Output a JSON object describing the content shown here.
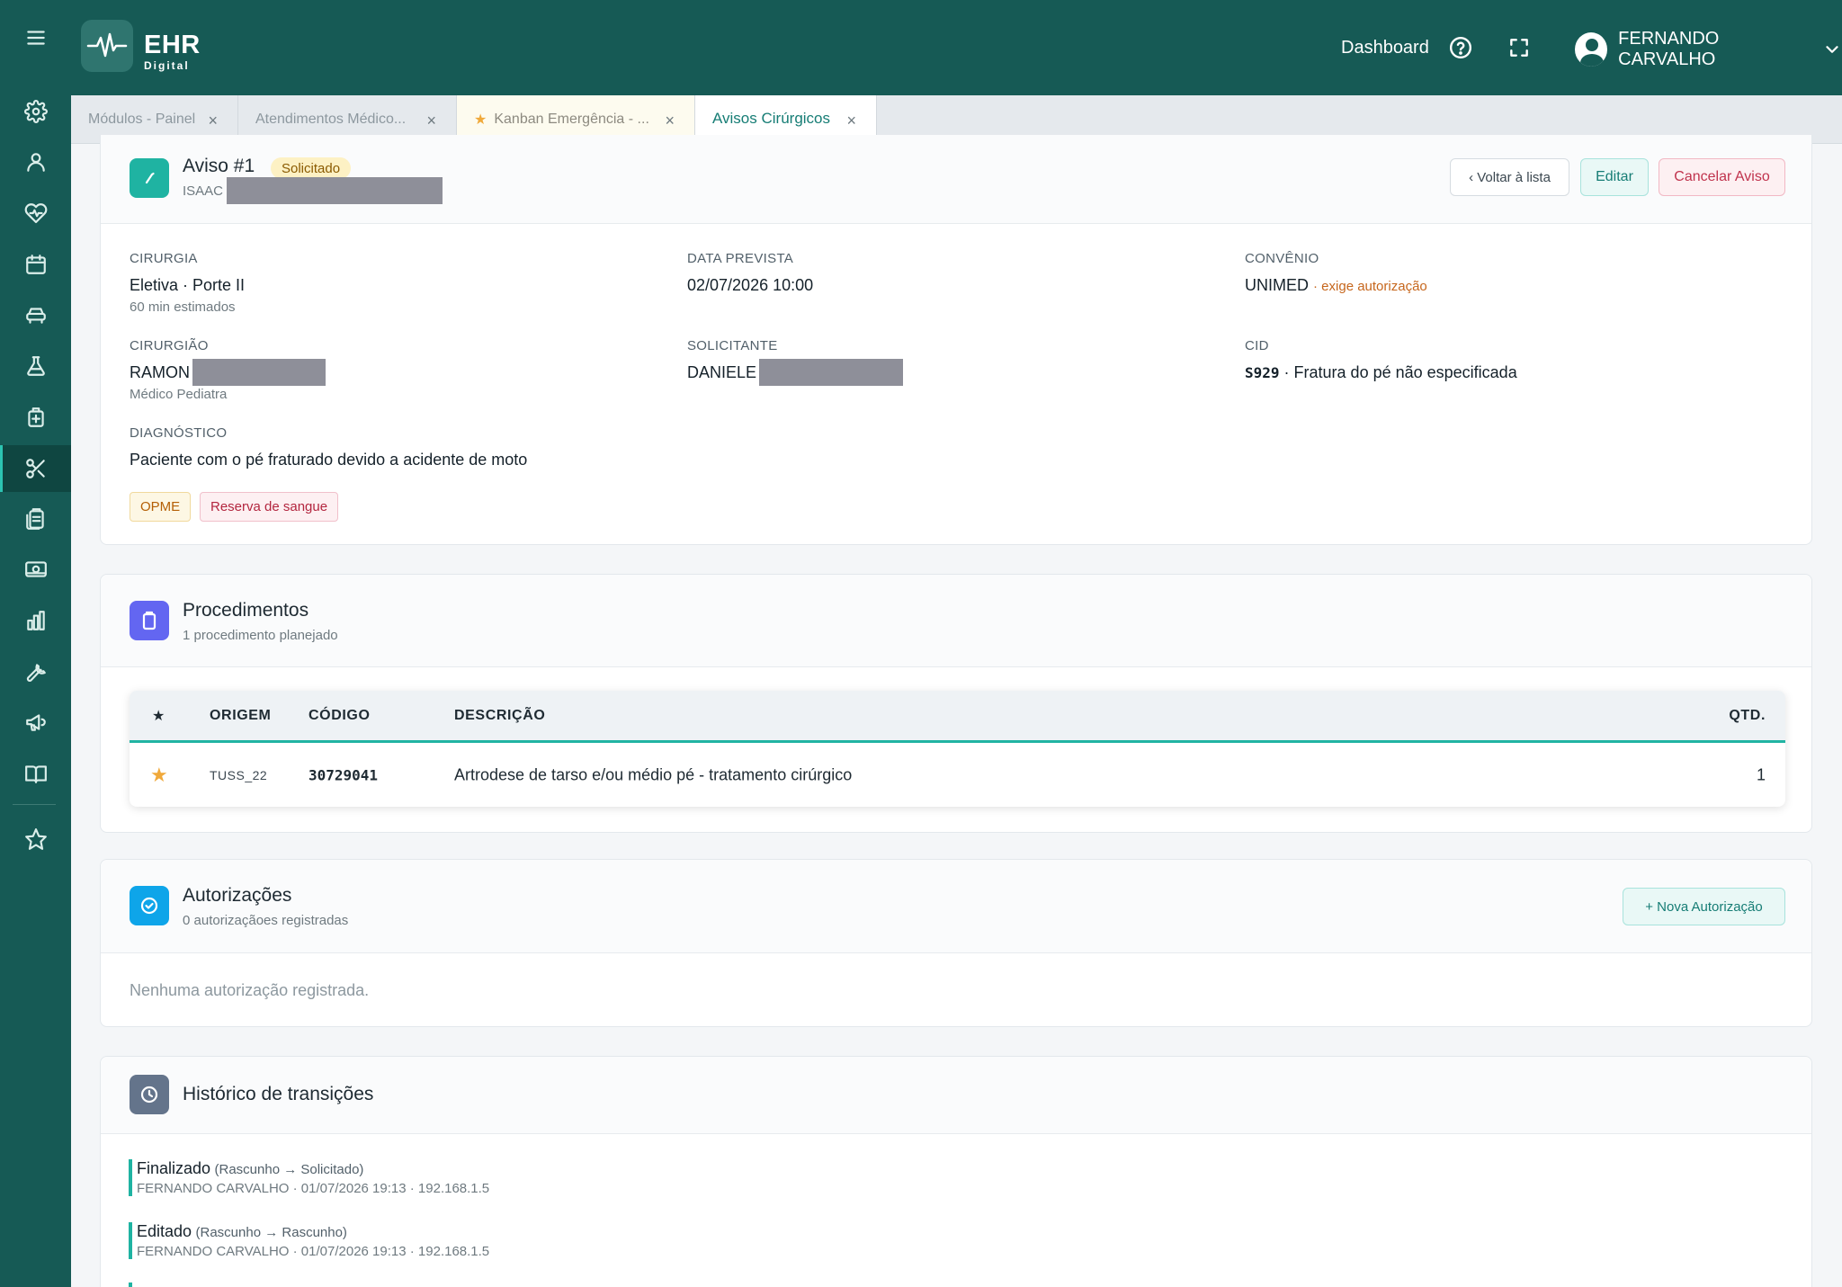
{
  "app": {
    "logo_title": "EHR",
    "logo_subtitle": "Digital",
    "header_link": "Dashboard",
    "user_name": "FERNANDO CARVALHO"
  },
  "tabs": [
    {
      "label": "Módulos - Painel"
    },
    {
      "label": "Atendimentos Médico..."
    },
    {
      "label": "Kanban Emergência - ..."
    },
    {
      "label": "Avisos Cirúrgicos"
    }
  ],
  "tab_close": "×",
  "aviso": {
    "title": "Aviso #1",
    "status": "Solicitado",
    "patient_first": "ISAAC",
    "back_button": "‹ Voltar à lista",
    "edit_button": "Editar",
    "cancel_button": "Cancelar Aviso",
    "fields": {
      "cirurgia_label": "CIRURGIA",
      "cirurgia_value": "Eletiva · Porte II",
      "cirurgia_note": "60 min estimados",
      "data_label": "DATA PREVISTA",
      "data_value": "02/07/2026 10:00",
      "convenio_label": "CONVÊNIO",
      "convenio_value": "UNIMED",
      "convenio_note": "· exige autorização",
      "cirurgiao_label": "CIRURGIÃO",
      "cirurgiao_value": "RAMON",
      "cirurgiao_note": "Médico Pediatra",
      "solicitante_label": "SOLICITANTE",
      "solicitante_value": "DANIELE",
      "cid_label": "CID",
      "cid_code": "S929",
      "cid_desc": "· Fratura do pé não especificada",
      "diagnostico_label": "DIAGNÓSTICO",
      "diagnostico_value": "Paciente com o pé fraturado devido a acidente de moto"
    },
    "tags": [
      "OPME",
      "Reserva de sangue"
    ]
  },
  "procedimentos": {
    "title": "Procedimentos",
    "subtitle": "1 procedimento planejado",
    "columns": {
      "star": "★",
      "origem": "ORIGEM",
      "codigo": "CÓDIGO",
      "descricao": "DESCRIÇÃO",
      "qtd": "QTD."
    },
    "rows": [
      {
        "star": "★",
        "origem": "TUSS_22",
        "codigo": "30729041",
        "descricao": "Artrodese de tarso e/ou médio pé - tratamento cirúrgico",
        "qtd": "1"
      }
    ]
  },
  "autorizacoes": {
    "title": "Autorizações",
    "subtitle": "0 autorizaçãoes registradas",
    "new_button": "+ Nova Autorização",
    "empty": "Nenhuma autorização registrada."
  },
  "historico": {
    "title": "Histórico de transições",
    "items": [
      {
        "action": "Finalizado",
        "transition": "(Rascunho → Solicitado)",
        "meta": "FERNANDO CARVALHO · 01/07/2026 19:13 · 192.168.1.5"
      },
      {
        "action": "Editado",
        "transition": "(Rascunho → Rascunho)",
        "meta": "FERNANDO CARVALHO · 01/07/2026 19:13 · 192.168.1.5"
      }
    ]
  },
  "colors": {
    "primary": "#165a55",
    "accent": "#1fb3a2",
    "status_bg": "#fdf1c4",
    "danger": "#c0334d"
  }
}
